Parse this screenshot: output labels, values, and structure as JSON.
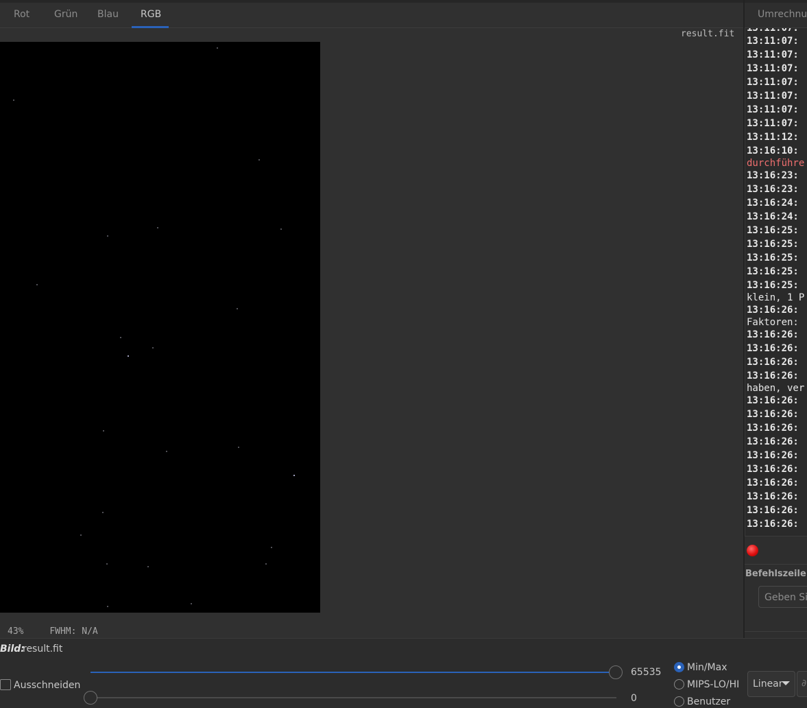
{
  "tabs": [
    {
      "label": "Rot"
    },
    {
      "label": "Grün"
    },
    {
      "label": "Blau"
    },
    {
      "label": "RGB"
    }
  ],
  "active_tab": "RGB",
  "image": {
    "filename": "result.fit",
    "zoom": "43%",
    "fwhm": "FWHM: N/A"
  },
  "right_panel": {
    "tab_label": "Umrechnung",
    "log_lines": [
      {
        "text": "13:11:07:",
        "style": "b"
      },
      {
        "text": "13:11:07:",
        "style": "b"
      },
      {
        "text": "13:11:07:",
        "style": "b"
      },
      {
        "text": "13:11:07:",
        "style": "b"
      },
      {
        "text": "13:11:07:",
        "style": "b"
      },
      {
        "text": "13:11:07:",
        "style": "b"
      },
      {
        "text": "13:11:07:",
        "style": "b"
      },
      {
        "text": "13:11:12:",
        "style": "b"
      },
      {
        "text": "13:16:10:",
        "style": "b"
      },
      {
        "text": "durchführe",
        "style": "red"
      },
      {
        "text": "13:16:23:",
        "style": "b"
      },
      {
        "text": "13:16:23:",
        "style": "b"
      },
      {
        "text": "13:16:24:",
        "style": "b"
      },
      {
        "text": "13:16:24:",
        "style": "b"
      },
      {
        "text": "13:16:25:",
        "style": "b"
      },
      {
        "text": "13:16:25:",
        "style": "b"
      },
      {
        "text": "13:16:25:",
        "style": "b"
      },
      {
        "text": "13:16:25:",
        "style": "b"
      },
      {
        "text": "13:16:25:",
        "style": "b"
      },
      {
        "text": "klein, 1 P",
        "style": "n"
      },
      {
        "text": "13:16:26:",
        "style": "b"
      },
      {
        "text": "Faktoren:",
        "style": "n"
      },
      {
        "text": "13:16:26:",
        "style": "b"
      },
      {
        "text": "13:16:26:",
        "style": "b"
      },
      {
        "text": "13:16:26:",
        "style": "b"
      },
      {
        "text": "13:16:26:",
        "style": "b"
      },
      {
        "text": "haben, ver",
        "style": "n"
      },
      {
        "text": "13:16:26:",
        "style": "b"
      },
      {
        "text": "13:16:26:",
        "style": "b"
      },
      {
        "text": "13:16:26:",
        "style": "b"
      },
      {
        "text": "13:16:26:",
        "style": "b"
      },
      {
        "text": "13:16:26:",
        "style": "b"
      },
      {
        "text": "13:16:26:",
        "style": "b"
      },
      {
        "text": "13:16:26:",
        "style": "b"
      },
      {
        "text": "13:16:26:",
        "style": "b"
      },
      {
        "text": "13:16:26:",
        "style": "b"
      },
      {
        "text": "13:16:26:",
        "style": "b"
      }
    ],
    "status_color": "#e01010",
    "command_label": "Befehlszeile",
    "command_placeholder": "Geben Sie"
  },
  "bottom": {
    "bild_label": "Bild:",
    "bild_value": "result.fit",
    "crop_label": "Ausschneiden",
    "crop_checked": false,
    "slider_hi_value": "65535",
    "slider_lo_value": "0",
    "slider_hi_fraction": 1.0,
    "slider_lo_fraction": 0.0,
    "radio_options": [
      {
        "label": "Min/Max",
        "checked": true
      },
      {
        "label": "MIPS-LO/HI",
        "checked": false
      },
      {
        "label": "Benutzer",
        "checked": false
      }
    ],
    "scale_select": "Linear"
  },
  "colors": {
    "accent": "#2a62b9",
    "background": "#303030"
  }
}
